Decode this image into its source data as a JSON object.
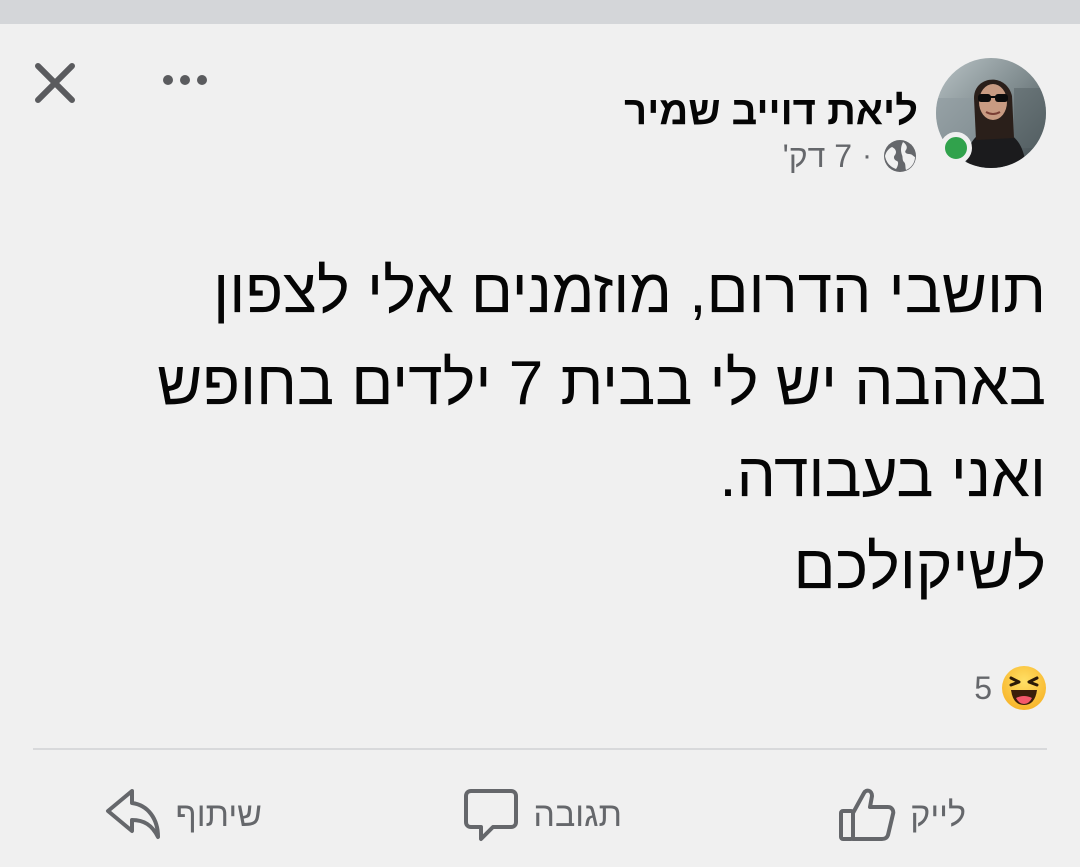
{
  "post": {
    "author": "ליאת דוייב שמיר",
    "time": "7 דק'",
    "separator": "·",
    "privacy_icon": "globe-icon",
    "online": true,
    "online_color": "#31a24c",
    "text_lines": [
      "תושבי הדרום, מוזמנים אלי לצפון",
      "באהבה יש לי בבית 7 ילדים בחופש",
      "ואני בעבודה.",
      "לשיקולכם"
    ],
    "reactions": {
      "icon": "laugh-emoji-icon",
      "count": "5"
    }
  },
  "actions": {
    "like": "לייק",
    "comment": "תגובה",
    "share": "שיתוף"
  },
  "header_icons": {
    "close": "close-icon",
    "more": "more-options-icon"
  }
}
